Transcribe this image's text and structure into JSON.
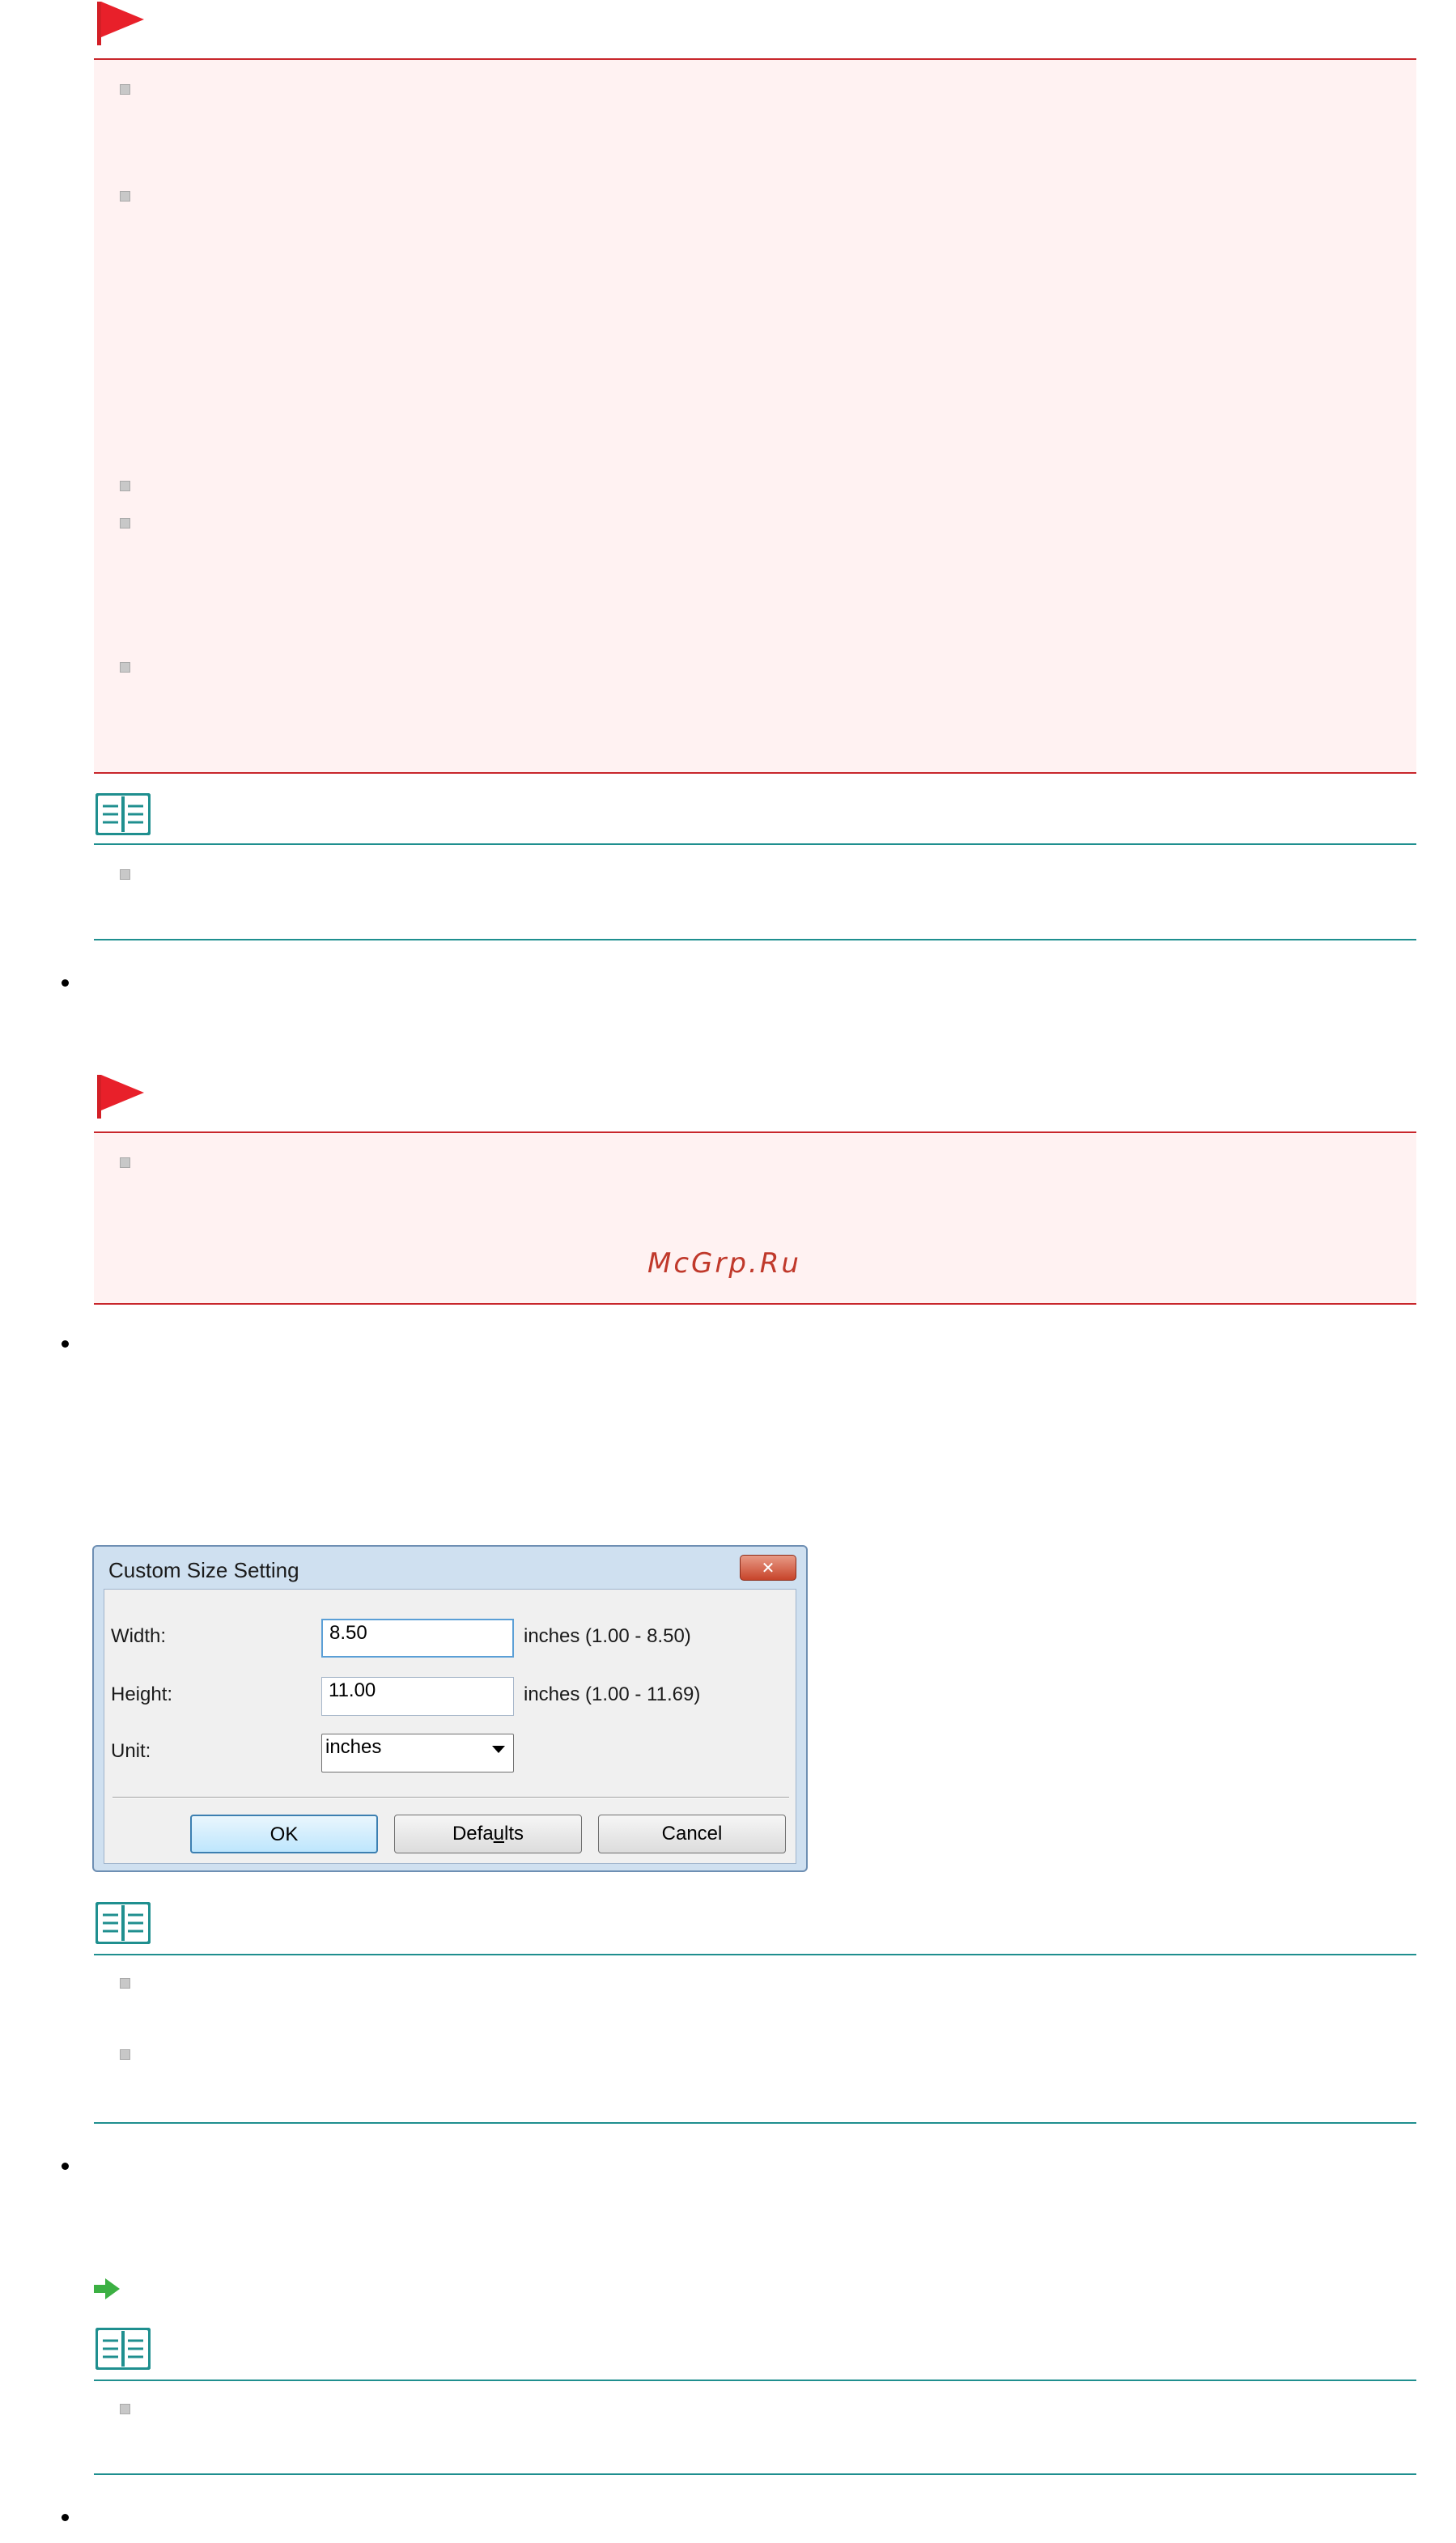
{
  "watermark": "McGrp.Ru",
  "custom_size_dialog": {
    "title": "Custom Size Setting",
    "close_glyph": "✕",
    "width_label": "Width:",
    "width_value": "8.50",
    "width_range": "inches (1.00 - 8.50)",
    "height_label": "Height:",
    "height_value": "11.00",
    "height_range": "inches (1.00 - 11.69)",
    "unit_label": "Unit:",
    "unit_value": "inches",
    "ok_label": "OK",
    "defaults_label_pre": "Defa",
    "defaults_label_mnemonic": "u",
    "defaults_label_post": "lts",
    "cancel_label": "Cancel"
  },
  "icons": {
    "important": "red-flag-icon",
    "note": "open-book-icon",
    "link": "green-arrow-icon"
  },
  "colors": {
    "important_border": "#c8262b",
    "important_background": "#fff2f2",
    "note_rule": "#1f8f8f",
    "link_arrow": "#3cb043"
  }
}
